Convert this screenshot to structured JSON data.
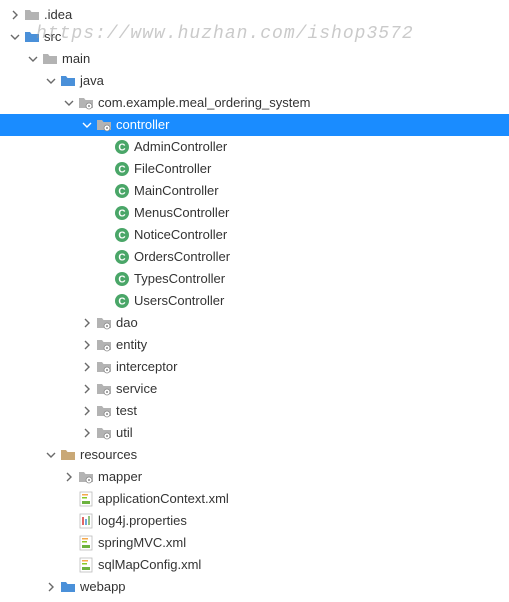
{
  "watermark": "https://www.huzhan.com/ishop3572",
  "icons": {
    "folder_gray": "#8a8a8a",
    "folder_blue": "#4a90d9",
    "folder_tan": "#c9a876",
    "package": "#8a8a8a",
    "class_circle": "#4aa668",
    "xml_spring": "#6db33f",
    "properties": "#8a8a8a"
  },
  "tree": [
    {
      "depth": 0,
      "chev": "right",
      "icon": "folder_gray",
      "label": ".idea"
    },
    {
      "depth": 0,
      "chev": "down",
      "icon": "folder_blue",
      "label": "src"
    },
    {
      "depth": 1,
      "chev": "down",
      "icon": "folder_gray",
      "label": "main"
    },
    {
      "depth": 2,
      "chev": "down",
      "icon": "folder_blue",
      "label": "java"
    },
    {
      "depth": 3,
      "chev": "down",
      "icon": "package",
      "label": "com.example.meal_ordering_system"
    },
    {
      "depth": 4,
      "chev": "down",
      "icon": "package",
      "label": "controller",
      "selected": true
    },
    {
      "depth": 5,
      "chev": "none",
      "icon": "class",
      "label": "AdminController"
    },
    {
      "depth": 5,
      "chev": "none",
      "icon": "class",
      "label": "FileController"
    },
    {
      "depth": 5,
      "chev": "none",
      "icon": "class",
      "label": "MainController"
    },
    {
      "depth": 5,
      "chev": "none",
      "icon": "class",
      "label": "MenusController"
    },
    {
      "depth": 5,
      "chev": "none",
      "icon": "class",
      "label": "NoticeController"
    },
    {
      "depth": 5,
      "chev": "none",
      "icon": "class",
      "label": "OrdersController"
    },
    {
      "depth": 5,
      "chev": "none",
      "icon": "class",
      "label": "TypesController"
    },
    {
      "depth": 5,
      "chev": "none",
      "icon": "class",
      "label": "UsersController"
    },
    {
      "depth": 4,
      "chev": "right",
      "icon": "package",
      "label": "dao"
    },
    {
      "depth": 4,
      "chev": "right",
      "icon": "package",
      "label": "entity"
    },
    {
      "depth": 4,
      "chev": "right",
      "icon": "package",
      "label": "interceptor"
    },
    {
      "depth": 4,
      "chev": "right",
      "icon": "package",
      "label": "service"
    },
    {
      "depth": 4,
      "chev": "right",
      "icon": "package",
      "label": "test"
    },
    {
      "depth": 4,
      "chev": "right",
      "icon": "package",
      "label": "util"
    },
    {
      "depth": 2,
      "chev": "down",
      "icon": "folder_tan",
      "label": "resources"
    },
    {
      "depth": 3,
      "chev": "right",
      "icon": "package",
      "label": "mapper"
    },
    {
      "depth": 3,
      "chev": "none",
      "icon": "xml",
      "label": "applicationContext.xml"
    },
    {
      "depth": 3,
      "chev": "none",
      "icon": "props",
      "label": "log4j.properties"
    },
    {
      "depth": 3,
      "chev": "none",
      "icon": "xml",
      "label": "springMVC.xml"
    },
    {
      "depth": 3,
      "chev": "none",
      "icon": "xml",
      "label": "sqlMapConfig.xml"
    },
    {
      "depth": 2,
      "chev": "right",
      "icon": "folder_blue",
      "label": "webapp"
    }
  ]
}
